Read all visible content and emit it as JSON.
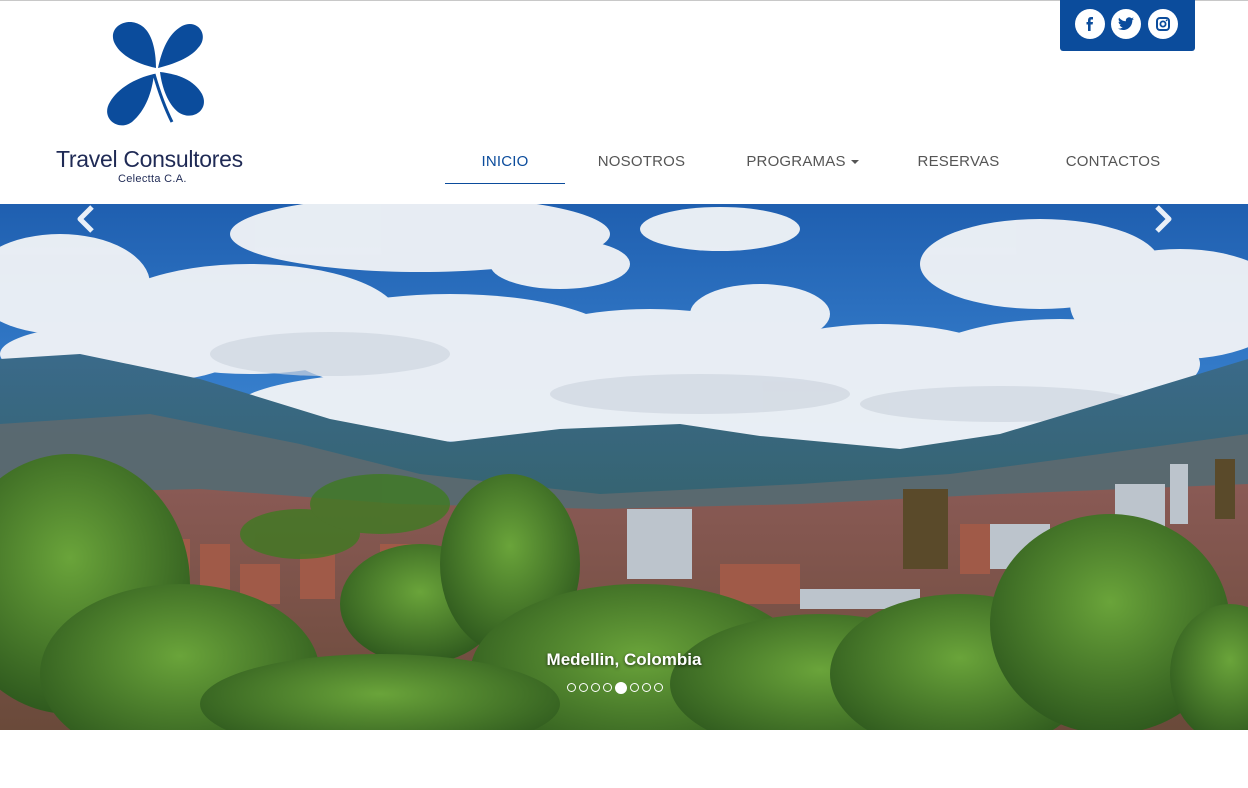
{
  "brand": {
    "name": "Travel Consultores",
    "subtitle": "Celectta C.A.",
    "logo_icon": "clover-icon",
    "color": "#0b4c9c"
  },
  "social": {
    "icons": [
      "facebook-icon",
      "twitter-icon",
      "instagram-icon"
    ],
    "background": "#0b4c9c"
  },
  "nav": {
    "items": [
      {
        "label": "INICIO",
        "active": true
      },
      {
        "label": "NOSOTROS",
        "active": false
      },
      {
        "label": "PROGRAMAS",
        "active": false,
        "dropdown": true
      },
      {
        "label": "RESERVAS",
        "active": false
      },
      {
        "label": "CONTACTOS",
        "active": false
      }
    ]
  },
  "carousel": {
    "caption": "Medellin, Colombia",
    "slide_count": 8,
    "active_slide": 5,
    "prev_icon": "chevron-left-icon",
    "next_icon": "chevron-right-icon"
  }
}
